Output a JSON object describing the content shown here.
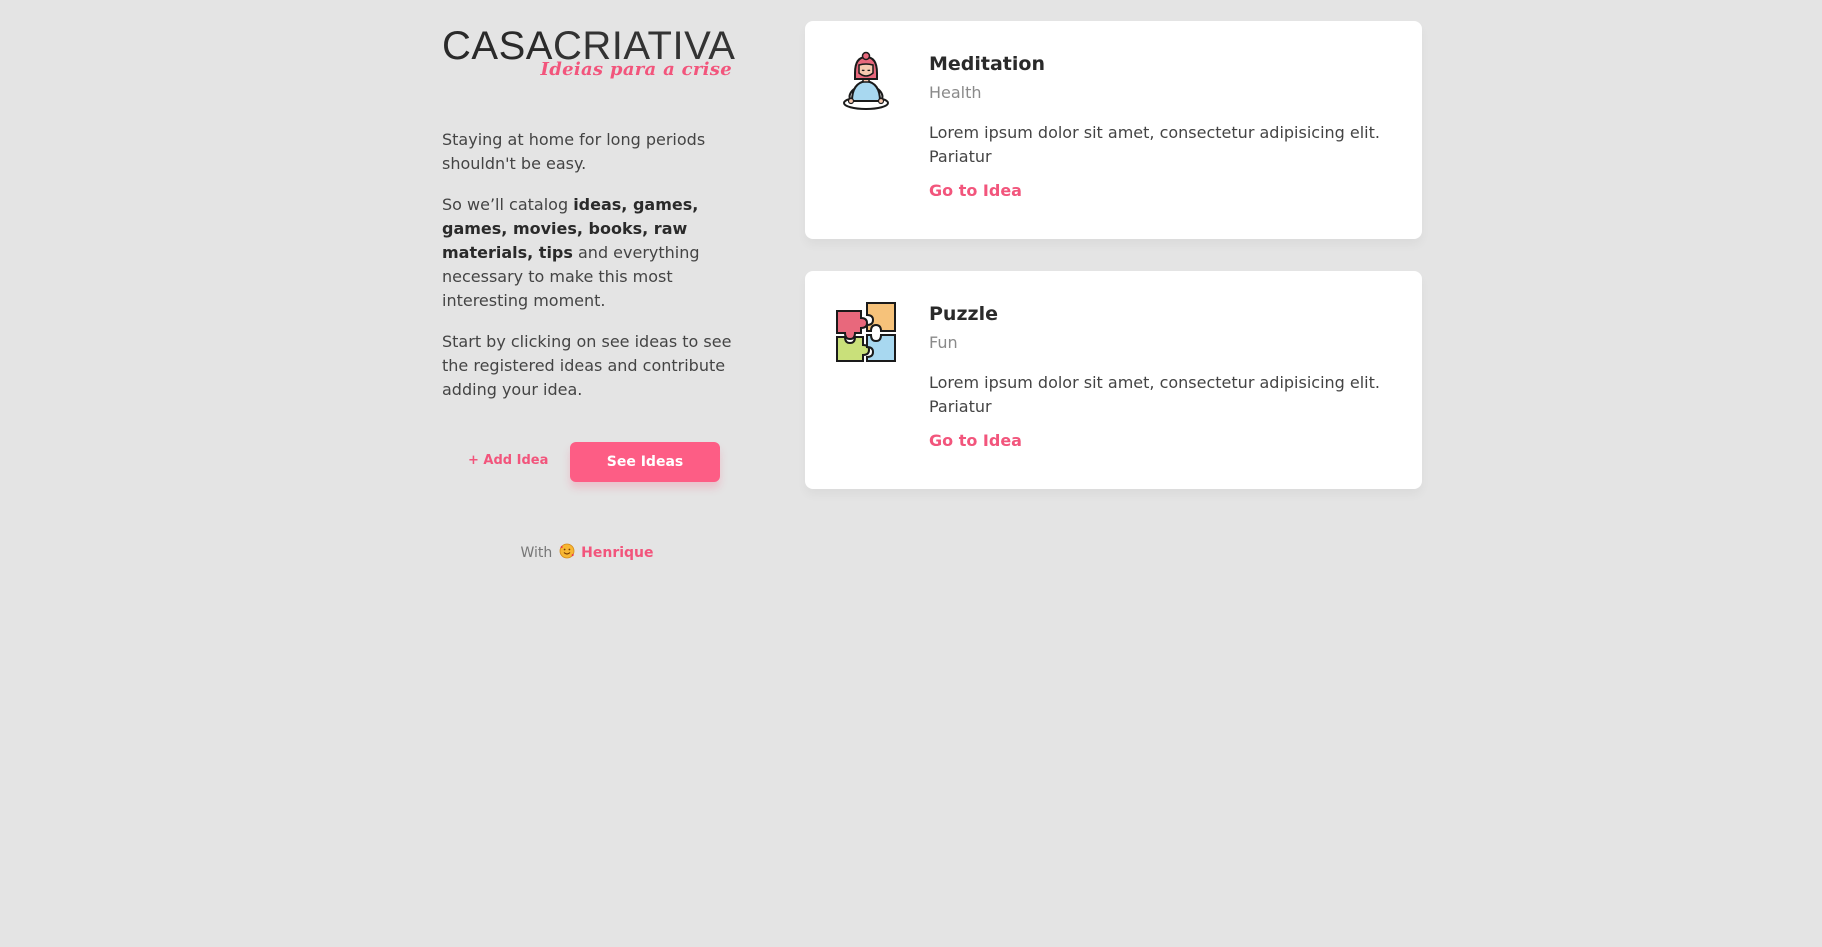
{
  "brand": {
    "name_bold": "CASA",
    "name_thin": "CRIATIVA",
    "tagline": "Ideias para a crise"
  },
  "intro": {
    "p1": "Staying at home for long periods shouldn't be easy.",
    "p2_start": "So we’ll catalog ",
    "p2_bold": "ideas, games, games, movies, books, raw materials, tips",
    "p2_end": " and everything necessary to make this most interesting moment.",
    "p3": "Start by clicking on see ideas to see the registered ideas and contribute adding your idea."
  },
  "actions": {
    "add_label": "+ Add Idea",
    "see_label": "See Ideas"
  },
  "footer": {
    "prefix": "With",
    "author": "Henrique"
  },
  "ideas": [
    {
      "title": "Meditation",
      "category": "Health",
      "description": "Lorem ipsum dolor sit amet, consectetur adipisicing elit. Pariatur",
      "link_label": "Go to Idea",
      "icon": "meditation-icon"
    },
    {
      "title": "Puzzle",
      "category": "Fun",
      "description": "Lorem ipsum dolor sit amet, consectetur adipisicing elit. Pariatur",
      "link_label": "Go to Idea",
      "icon": "puzzle-icon"
    }
  ],
  "colors": {
    "accent": "#fd5d85",
    "background": "#e4e4e4",
    "card": "#ffffff"
  }
}
